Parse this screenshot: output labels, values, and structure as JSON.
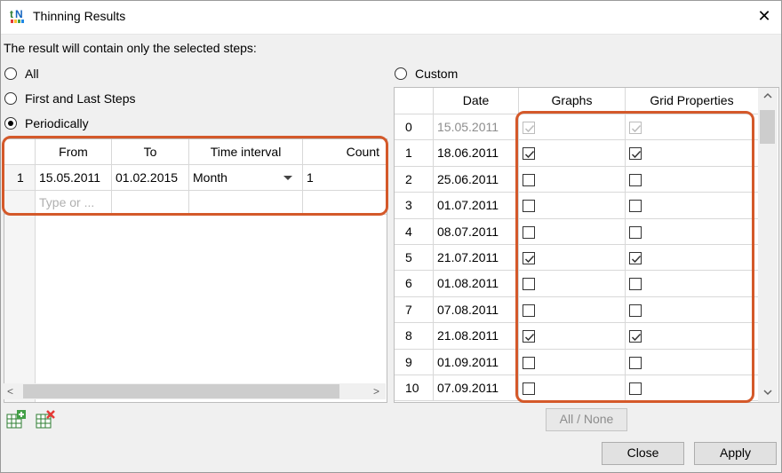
{
  "window": {
    "title": "Thinning Results",
    "close_glyph": "✕"
  },
  "instruction": "The result will contain only the selected steps:",
  "options": {
    "all": "All",
    "first_last": "First and Last Steps",
    "periodically": "Periodically",
    "custom": "Custom",
    "selected": "periodically"
  },
  "periodic_table": {
    "headers": [
      "From",
      "To",
      "Time interval",
      "Count"
    ],
    "rows": [
      {
        "index": "1",
        "from": "15.05.2011",
        "to": "01.02.2015",
        "interval": "Month",
        "count": "1"
      }
    ],
    "new_row_placeholder": "Type or ..."
  },
  "custom_table": {
    "headers": [
      "Date",
      "Graphs",
      "Grid Properties"
    ],
    "rows": [
      {
        "index": "0",
        "date": "15.05.2011",
        "graphs": true,
        "grid": true,
        "disabled": true
      },
      {
        "index": "1",
        "date": "18.06.2011",
        "graphs": true,
        "grid": true
      },
      {
        "index": "2",
        "date": "25.06.2011",
        "graphs": false,
        "grid": false
      },
      {
        "index": "3",
        "date": "01.07.2011",
        "graphs": false,
        "grid": false
      },
      {
        "index": "4",
        "date": "08.07.2011",
        "graphs": false,
        "grid": false
      },
      {
        "index": "5",
        "date": "21.07.2011",
        "graphs": true,
        "grid": true
      },
      {
        "index": "6",
        "date": "01.08.2011",
        "graphs": false,
        "grid": false
      },
      {
        "index": "7",
        "date": "07.08.2011",
        "graphs": false,
        "grid": false
      },
      {
        "index": "8",
        "date": "21.08.2011",
        "graphs": true,
        "grid": true
      },
      {
        "index": "9",
        "date": "01.09.2011",
        "graphs": false,
        "grid": false
      },
      {
        "index": "10",
        "date": "07.09.2011",
        "graphs": false,
        "grid": false
      }
    ]
  },
  "buttons": {
    "all_none": "All / None",
    "close": "Close",
    "apply": "Apply"
  },
  "icons": {
    "app": "thinning-app-icon",
    "add_row": "add-row-icon",
    "delete_row": "delete-row-icon"
  },
  "colors": {
    "highlight_top": "#e07a2e",
    "highlight_bottom": "#b81c1c",
    "accent": "#d4592a"
  }
}
